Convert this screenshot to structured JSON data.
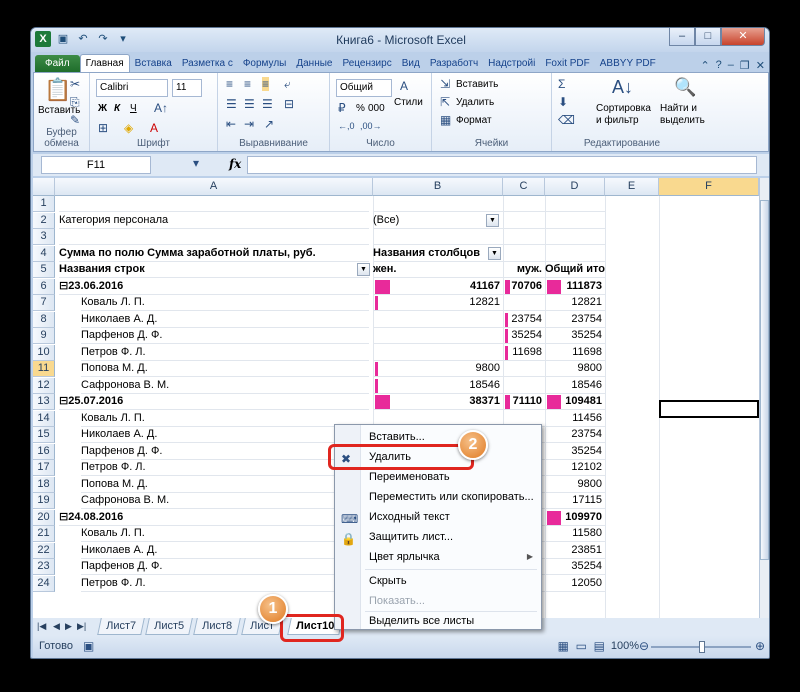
{
  "window": {
    "title": "Книга6 - Microsoft Excel"
  },
  "ribbon": {
    "tabs": [
      "Файл",
      "Главная",
      "Вставка",
      "Разметка с",
      "Формулы",
      "Данные",
      "Рецензирс",
      "Вид",
      "Разработч",
      "Надстройі",
      "Foxit PDF",
      "ABBYY PDF"
    ],
    "clipboard": {
      "paste": "Вставить",
      "label": "Буфер обмена"
    },
    "font": {
      "name": "Calibri",
      "size": "11",
      "bold": "Ж",
      "italic": "К",
      "underline": "Ч",
      "label": "Шрифт"
    },
    "alignment": {
      "label": "Выравнивание"
    },
    "number": {
      "format": "Общий",
      "percent": "%",
      "thousands": "000",
      "label": "Число"
    },
    "styles": {
      "styles": "Стили"
    },
    "cells": {
      "insert": "Вставить",
      "delete": "Удалить",
      "format": "Формат",
      "label": "Ячейки"
    },
    "editing": {
      "sort": "Сортировка",
      "sort2": "и фильтр",
      "find": "Найти и",
      "find2": "выделить",
      "label": "Редактирование"
    }
  },
  "formula_bar": {
    "name_box": "F11",
    "fx": "fx",
    "value": ""
  },
  "columns": [
    "A",
    "B",
    "C",
    "D",
    "E",
    "F"
  ],
  "rows": [
    {
      "n": "1",
      "a": "",
      "b": "",
      "c": "",
      "d": ""
    },
    {
      "n": "2",
      "a": "Категория персонала",
      "b": "(Все)",
      "c": "",
      "d": ""
    },
    {
      "n": "3",
      "a": "",
      "b": "",
      "c": "",
      "d": ""
    },
    {
      "n": "4",
      "a": "Сумма по полю Сумма заработной платы, руб.",
      "b": "Названия столбцов",
      "c": "",
      "d": ""
    },
    {
      "n": "5",
      "a": "Названия строк",
      "b": "жен.",
      "c": "муж.",
      "d": "Общий итог"
    },
    {
      "n": "6",
      "a": "⊟23.06.2016",
      "b": "41167",
      "c": "70706",
      "d": "111873"
    },
    {
      "n": "7",
      "a": "Коваль Л. П.",
      "b": "12821",
      "c": "",
      "d": "12821"
    },
    {
      "n": "8",
      "a": "Николаев А. Д.",
      "b": "",
      "c": "23754",
      "d": "23754"
    },
    {
      "n": "9",
      "a": "Парфенов Д. Ф.",
      "b": "",
      "c": "35254",
      "d": "35254"
    },
    {
      "n": "10",
      "a": "Петров Ф. Л.",
      "b": "",
      "c": "11698",
      "d": "11698"
    },
    {
      "n": "11",
      "a": "Попова М. Д.",
      "b": "9800",
      "c": "",
      "d": "9800"
    },
    {
      "n": "12",
      "a": "Сафронова В. М.",
      "b": "18546",
      "c": "",
      "d": "18546"
    },
    {
      "n": "13",
      "a": "⊟25.07.2016",
      "b": "38371",
      "c": "71110",
      "d": "109481"
    },
    {
      "n": "14",
      "a": "Коваль Л. П.",
      "b": "",
      "c": "",
      "d": "11456"
    },
    {
      "n": "15",
      "a": "Николаев А. Д.",
      "b": "",
      "c": "",
      "d": "23754"
    },
    {
      "n": "16",
      "a": "Парфенов Д. Ф.",
      "b": "",
      "c": "",
      "d": "35254"
    },
    {
      "n": "17",
      "a": "Петров Ф. Л.",
      "b": "",
      "c": "",
      "d": "12102"
    },
    {
      "n": "18",
      "a": "Попова М. Д.",
      "b": "",
      "c": "",
      "d": "9800"
    },
    {
      "n": "19",
      "a": "Сафронова В. М.",
      "b": "",
      "c": "",
      "d": "17115"
    },
    {
      "n": "20",
      "a": "⊟24.08.2016",
      "b": "",
      "c": "",
      "d": "109970"
    },
    {
      "n": "21",
      "a": "Коваль Л. П.",
      "b": "",
      "c": "",
      "d": "11580"
    },
    {
      "n": "22",
      "a": "Николаев А. Д.",
      "b": "",
      "c": "",
      "d": "23851"
    },
    {
      "n": "23",
      "a": "Парфенов Д. Ф.",
      "b": "",
      "c": "",
      "d": "35254"
    },
    {
      "n": "24",
      "a": "Петров Ф. Л.",
      "b": "",
      "c": "",
      "d": "12050"
    }
  ],
  "sheet_tabs": [
    "Лист7",
    "Лист5",
    "Лист8",
    "Лист",
    "Лист10"
  ],
  "active_sheet": "Лист10",
  "context_menu": [
    {
      "label": "Вставить...",
      "enabled": true
    },
    {
      "label": "Удалить",
      "enabled": true
    },
    {
      "label": "Переименовать",
      "enabled": true
    },
    {
      "label": "Переместить или скопировать...",
      "enabled": true
    },
    {
      "label": "Исходный текст",
      "enabled": true
    },
    {
      "label": "Защитить лист...",
      "enabled": true
    },
    {
      "label": "Цвет ярлычка",
      "enabled": true
    },
    {
      "label": "Скрыть",
      "enabled": true
    },
    {
      "label": "Показать...",
      "enabled": false
    },
    {
      "label": "Выделить все листы",
      "enabled": true
    }
  ],
  "status": {
    "ready": "Готово",
    "zoom": "100%"
  },
  "callouts": [
    "1",
    "2"
  ],
  "colors": {
    "databar": "#e82a9a",
    "highlight": "#e0261f",
    "badge": "#e07a22"
  }
}
